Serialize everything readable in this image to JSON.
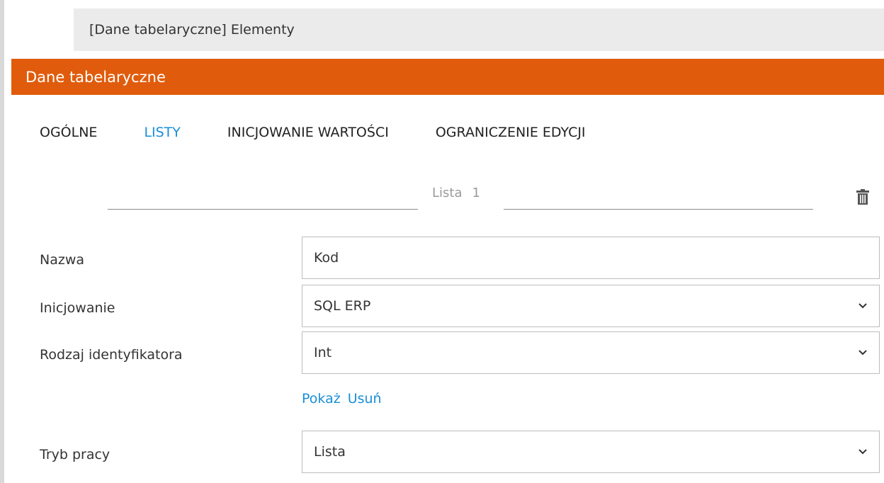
{
  "breadcrumb": "[Dane tabelaryczne] Elementy",
  "title": "Dane tabelaryczne",
  "tabs": [
    {
      "label": "OGÓLNE",
      "active": false
    },
    {
      "label": "LISTY",
      "active": true
    },
    {
      "label": "INICJOWANIE WARTOŚCI",
      "active": false
    },
    {
      "label": "OGRANICZENIE EDYCJI",
      "active": false
    }
  ],
  "list_header": {
    "label": "Lista",
    "number": "1"
  },
  "fields": {
    "nazwa": {
      "label": "Nazwa",
      "value": "Kod"
    },
    "inicjowanie": {
      "label": "Inicjowanie",
      "value": "SQL ERP"
    },
    "rodzaj": {
      "label": "Rodzaj identyfikatora",
      "value": "Int"
    },
    "tryb": {
      "label": "Tryb pracy",
      "value": "Lista"
    }
  },
  "links": {
    "show": "Pokaż",
    "remove": "Usuń"
  },
  "icons": {
    "delete": "trash-icon",
    "dropdown": "chevron-down-icon"
  },
  "colors": {
    "title_bar": "#e05c0c",
    "accent": "#1a8fd6",
    "breadcrumb_bg": "#ebebeb"
  }
}
